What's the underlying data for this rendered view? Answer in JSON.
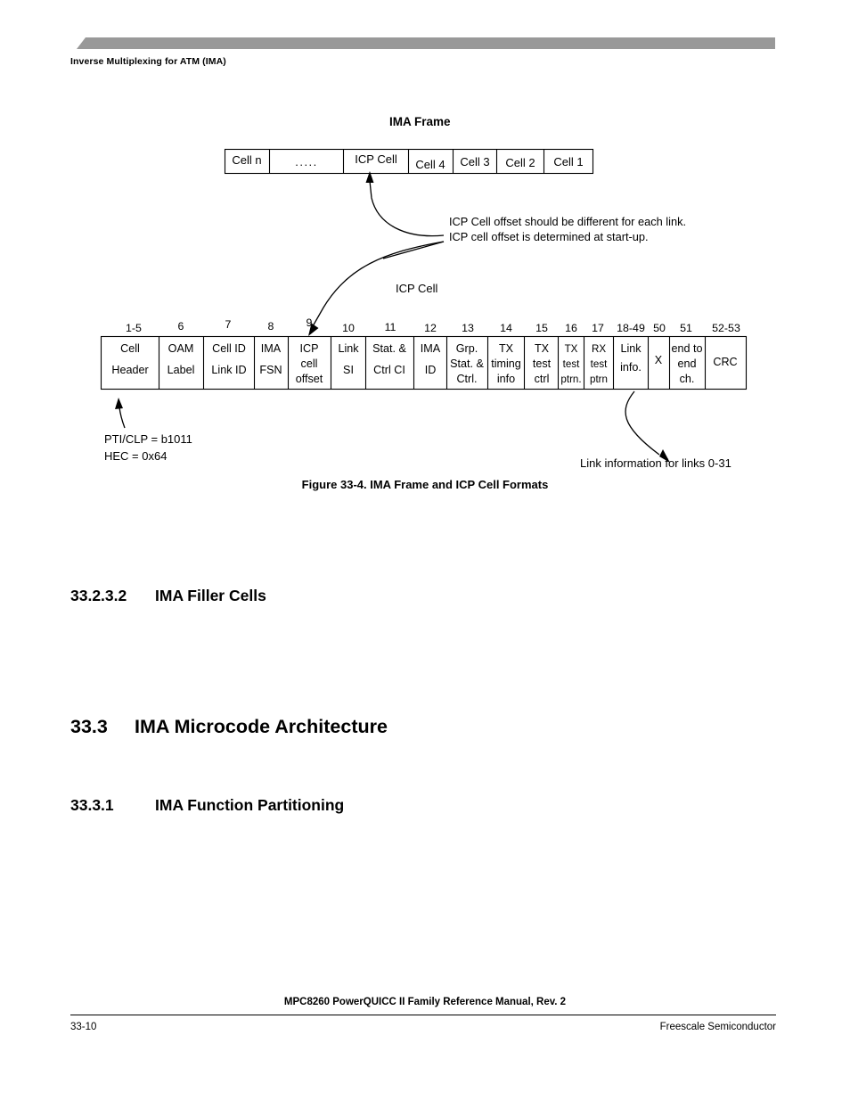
{
  "page": {
    "running_head": "Inverse Multiplexing for ATM (IMA)",
    "band_color": "#999999"
  },
  "figure": {
    "frame_title": "IMA Frame",
    "frame_cells": [
      {
        "label": "Cell n"
      },
      {
        "label": "....."
      },
      {
        "label": "ICP Cell"
      },
      {
        "label": "Cell 4"
      },
      {
        "label": "Cell 3"
      },
      {
        "label": "Cell 2"
      },
      {
        "label": "Cell 1"
      }
    ],
    "offset_notes": [
      "ICP Cell offset should be different for each link.",
      "ICP cell offset is determined at start-up."
    ],
    "icp_cell_label": "ICP Cell",
    "column_numbers": [
      "1-5",
      "6",
      "7",
      "8",
      "9",
      "10",
      "11",
      "12",
      "13",
      "14",
      "15",
      "16",
      "17",
      "18-49",
      "50",
      "51",
      "52-53"
    ],
    "icp_fields": [
      {
        "lines": [
          "Cell",
          "Header"
        ]
      },
      {
        "lines": [
          "OAM",
          "Label"
        ]
      },
      {
        "lines": [
          "Cell ID",
          "Link ID"
        ]
      },
      {
        "lines": [
          "IMA",
          "FSN"
        ]
      },
      {
        "lines": [
          "ICP",
          "cell",
          "offset"
        ]
      },
      {
        "lines": [
          "Link",
          "SI"
        ]
      },
      {
        "lines": [
          "Stat. &",
          "Ctrl CI"
        ]
      },
      {
        "lines": [
          "IMA",
          "ID"
        ]
      },
      {
        "lines": [
          "Grp.",
          "Stat. &",
          "Ctrl."
        ]
      },
      {
        "lines": [
          "TX",
          "timing",
          "info"
        ]
      },
      {
        "lines": [
          "TX",
          "test",
          "ctrl"
        ]
      },
      {
        "lines": [
          "TX",
          "test",
          "ptrn."
        ]
      },
      {
        "lines": [
          "RX",
          "test",
          "ptrn"
        ]
      },
      {
        "lines": [
          "Link",
          "info."
        ]
      },
      {
        "lines": [
          "X"
        ]
      },
      {
        "lines": [
          "end to",
          "end",
          "ch."
        ]
      },
      {
        "lines": [
          "CRC"
        ]
      }
    ],
    "pti_clp_note": "PTI/CLP  = b1011",
    "hec_note": "HEC = 0x64",
    "link_info_note": "Link information for links 0-31",
    "caption": "Figure 33-4. IMA Frame and ICP Cell Formats"
  },
  "sections": [
    {
      "number": "33.2.3.2",
      "title": "IMA Filler Cells",
      "level": "h3"
    },
    {
      "number": "33.3",
      "title": "IMA Microcode Architecture",
      "level": "h2"
    },
    {
      "number": "33.3.1",
      "title": "IMA Function Partitioning",
      "level": "h3"
    }
  ],
  "footer": {
    "title": "MPC8260 PowerQUICC II Family Reference Manual, Rev. 2",
    "page_number": "33-10",
    "company": "Freescale Semiconductor"
  }
}
